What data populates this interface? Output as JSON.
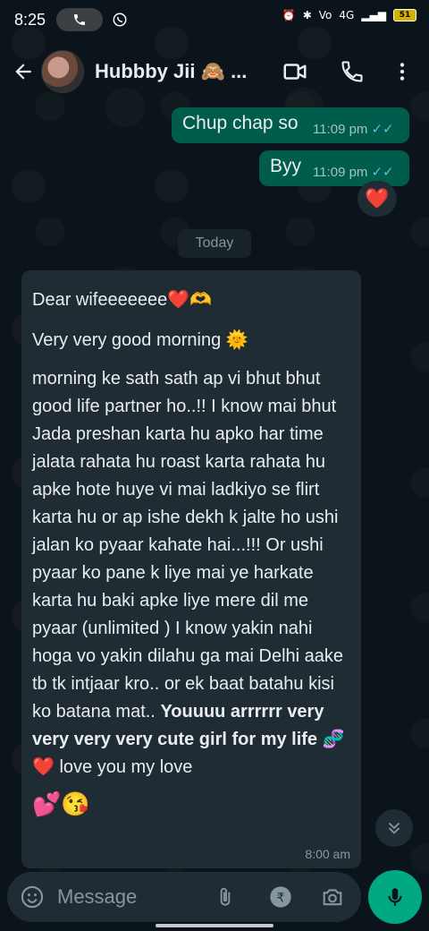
{
  "status_bar": {
    "time": "8:25",
    "network": "4G",
    "battery": "51"
  },
  "header": {
    "contact_name": "Hubbby Jii 🙈 ...",
    "icons": [
      "back-arrow-icon",
      "video-call-icon",
      "voice-call-icon",
      "more-options-icon"
    ]
  },
  "messages_out": [
    {
      "text": "Chup chap so",
      "time": "11:09 pm",
      "status": "read"
    },
    {
      "text": "Byy",
      "time": "11:09 pm",
      "status": "read",
      "reaction": "❤️"
    }
  ],
  "date_divider": "Today",
  "message_in": {
    "greeting": "Dear wifeeeeeee",
    "greeting_emoji": "❤️🫶",
    "line2": "Very very good morning 🌞",
    "body": "morning ke sath sath ap vi bhut bhut good life partner ho..!! I know mai bhut Jada preshan karta hu apko har time jalata rahata hu roast karta rahata hu apke hote huye vi mai ladkiyo se flirt karta hu or ap ishe dekh k jalte ho ushi jalan ko pyaar kahate hai...!!! Or ushi pyaar ko pane k liye mai ye harkate karta hu baki apke liye mere dil me pyaar (unlimited ) I know yakin nahi hoga vo yakin dilahu ga mai Delhi aake tb tk intjaar kro.. or ek baat batahu kisi ko batana mat..",
    "bold_text": "Youuuu arrrrrr very very very very cute girl for my life",
    "closing_emoji": "🧬❤️",
    "closing_text": " love you my love",
    "final_emoji": "💕😘",
    "time": "8:00 am"
  },
  "composer": {
    "placeholder": "Message",
    "icons": [
      "emoji-icon",
      "attach-icon",
      "rupee-payment-icon",
      "camera-icon",
      "mic-icon"
    ]
  },
  "colors": {
    "outgoing_bubble": "#005c4b",
    "incoming_bubble": "#202c33",
    "background": "#0b141a",
    "read_ticks": "#53bdeb",
    "mic_button": "#00a884"
  }
}
